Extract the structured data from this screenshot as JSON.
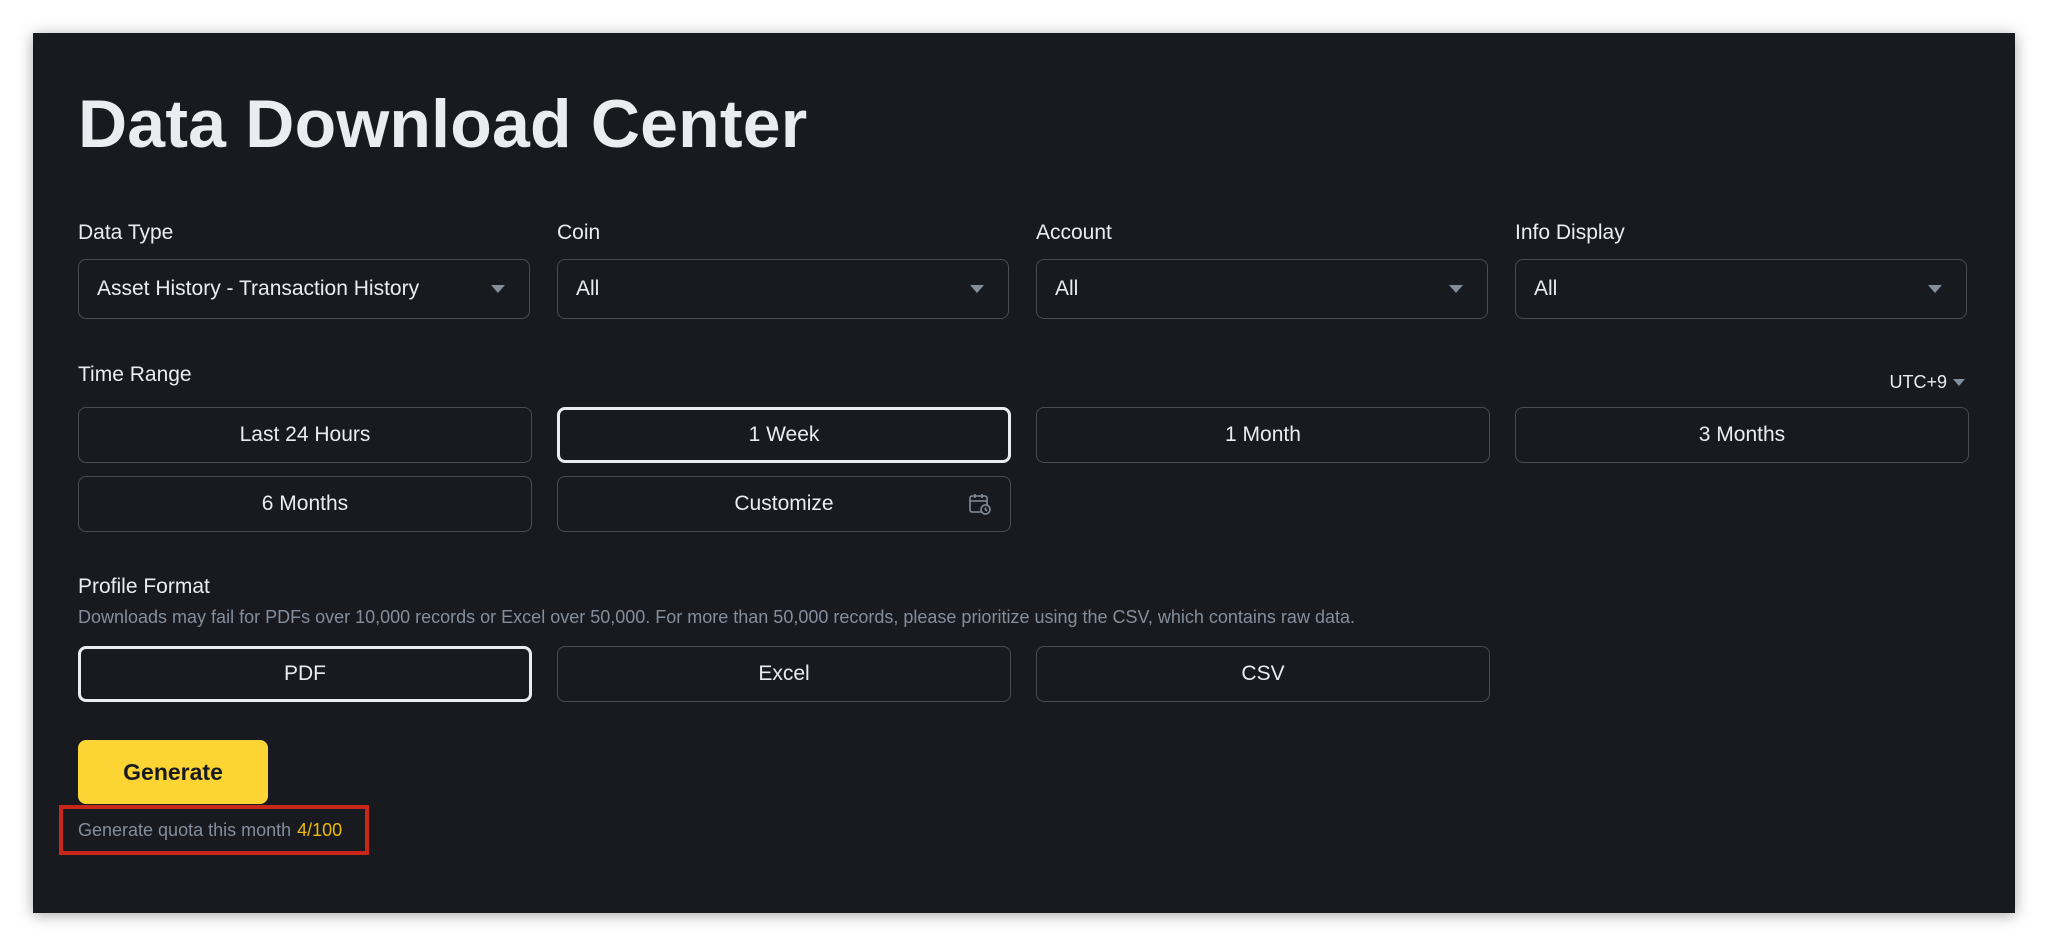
{
  "page": {
    "title": "Data Download Center"
  },
  "filters": {
    "data_type": {
      "label": "Data Type",
      "value": "Asset History - Transaction History"
    },
    "coin": {
      "label": "Coin",
      "value": "All"
    },
    "account": {
      "label": "Account",
      "value": "All"
    },
    "info_display": {
      "label": "Info Display",
      "value": "All"
    }
  },
  "time_range": {
    "label": "Time Range",
    "timezone": "UTC+9",
    "options": [
      "Last 24 Hours",
      "1 Week",
      "1 Month",
      "3 Months",
      "6 Months",
      "Customize"
    ],
    "selected": "1 Week"
  },
  "profile_format": {
    "label": "Profile Format",
    "hint": "Downloads may fail for PDFs over 10,000 records or Excel over 50,000. For more than 50,000 records, please prioritize using the CSV, which contains raw data.",
    "options": [
      "PDF",
      "Excel",
      "CSV"
    ],
    "selected": "PDF"
  },
  "actions": {
    "generate_label": "Generate"
  },
  "quota": {
    "label": "Generate quota this month",
    "count": "4/100"
  },
  "colors": {
    "background": "#181a20",
    "accent": "#fcd535",
    "quota_highlight": "#f0b90b",
    "annotation_box": "#c8281c"
  },
  "icons": {
    "dropdown": "chevron-down-icon",
    "calendar": "calendar-clock-icon"
  }
}
